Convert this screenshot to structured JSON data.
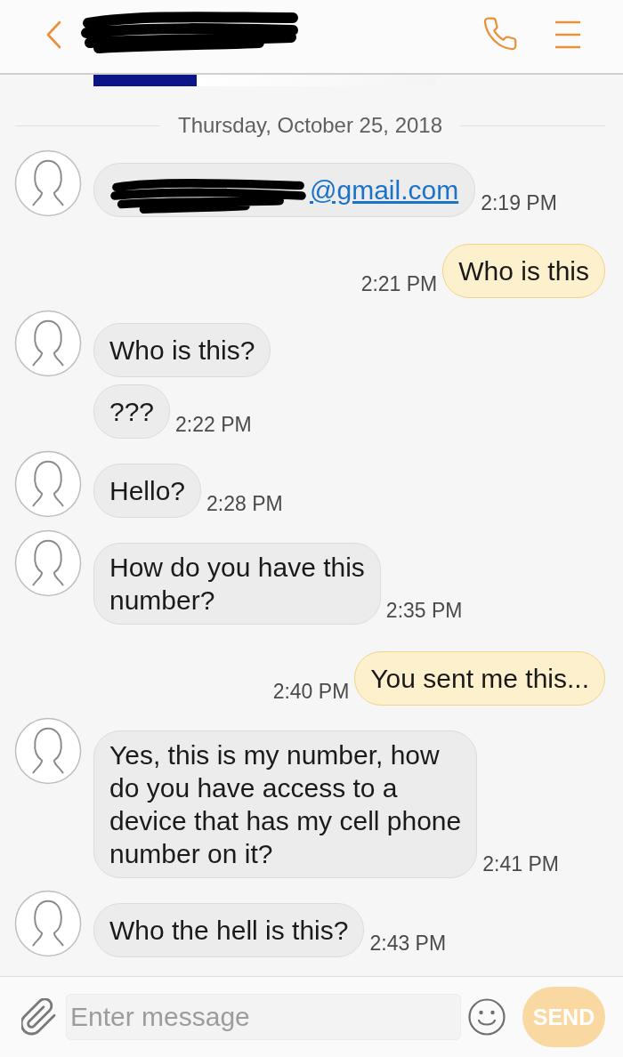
{
  "header": {
    "title_redacted": true
  },
  "thread": [
    {
      "kind": "image"
    },
    {
      "kind": "date",
      "text": "Thursday, October 25, 2018"
    },
    {
      "kind": "incoming",
      "bubbles": [
        {
          "kind": "link",
          "redacted": true,
          "text": "@gmail.com",
          "time": "2:19 PM"
        }
      ]
    },
    {
      "kind": "outgoing",
      "bubbles": [
        {
          "kind": "text",
          "lines": [
            "Who is this"
          ],
          "time": "2:21 PM"
        }
      ]
    },
    {
      "kind": "incoming",
      "bubbles": [
        {
          "kind": "text",
          "lines": [
            "Who is this?"
          ]
        },
        {
          "kind": "text",
          "lines": [
            "???"
          ],
          "time": "2:22 PM"
        }
      ]
    },
    {
      "kind": "incoming",
      "bubbles": [
        {
          "kind": "text",
          "lines": [
            "Hello?"
          ],
          "time": "2:28 PM"
        }
      ]
    },
    {
      "kind": "incoming",
      "bubbles": [
        {
          "kind": "text",
          "lines": [
            "How do you have this",
            "number?"
          ],
          "time": "2:35 PM"
        }
      ]
    },
    {
      "kind": "outgoing",
      "bubbles": [
        {
          "kind": "text",
          "lines": [
            "You sent me this..."
          ],
          "time": "2:40 PM"
        }
      ]
    },
    {
      "kind": "incoming",
      "bubbles": [
        {
          "kind": "text",
          "lines": [
            "Yes, this is my number, how",
            "do you have access to a",
            "device that has my cell phone",
            "number on it?"
          ],
          "time": "2:41 PM"
        }
      ]
    },
    {
      "kind": "incoming",
      "bubbles": [
        {
          "kind": "text",
          "lines": [
            "Who the hell is this?"
          ],
          "time": "2:43 PM"
        }
      ]
    }
  ],
  "composer": {
    "placeholder": "Enter message",
    "send": {
      "label": "SEND",
      "disabled": true
    }
  }
}
